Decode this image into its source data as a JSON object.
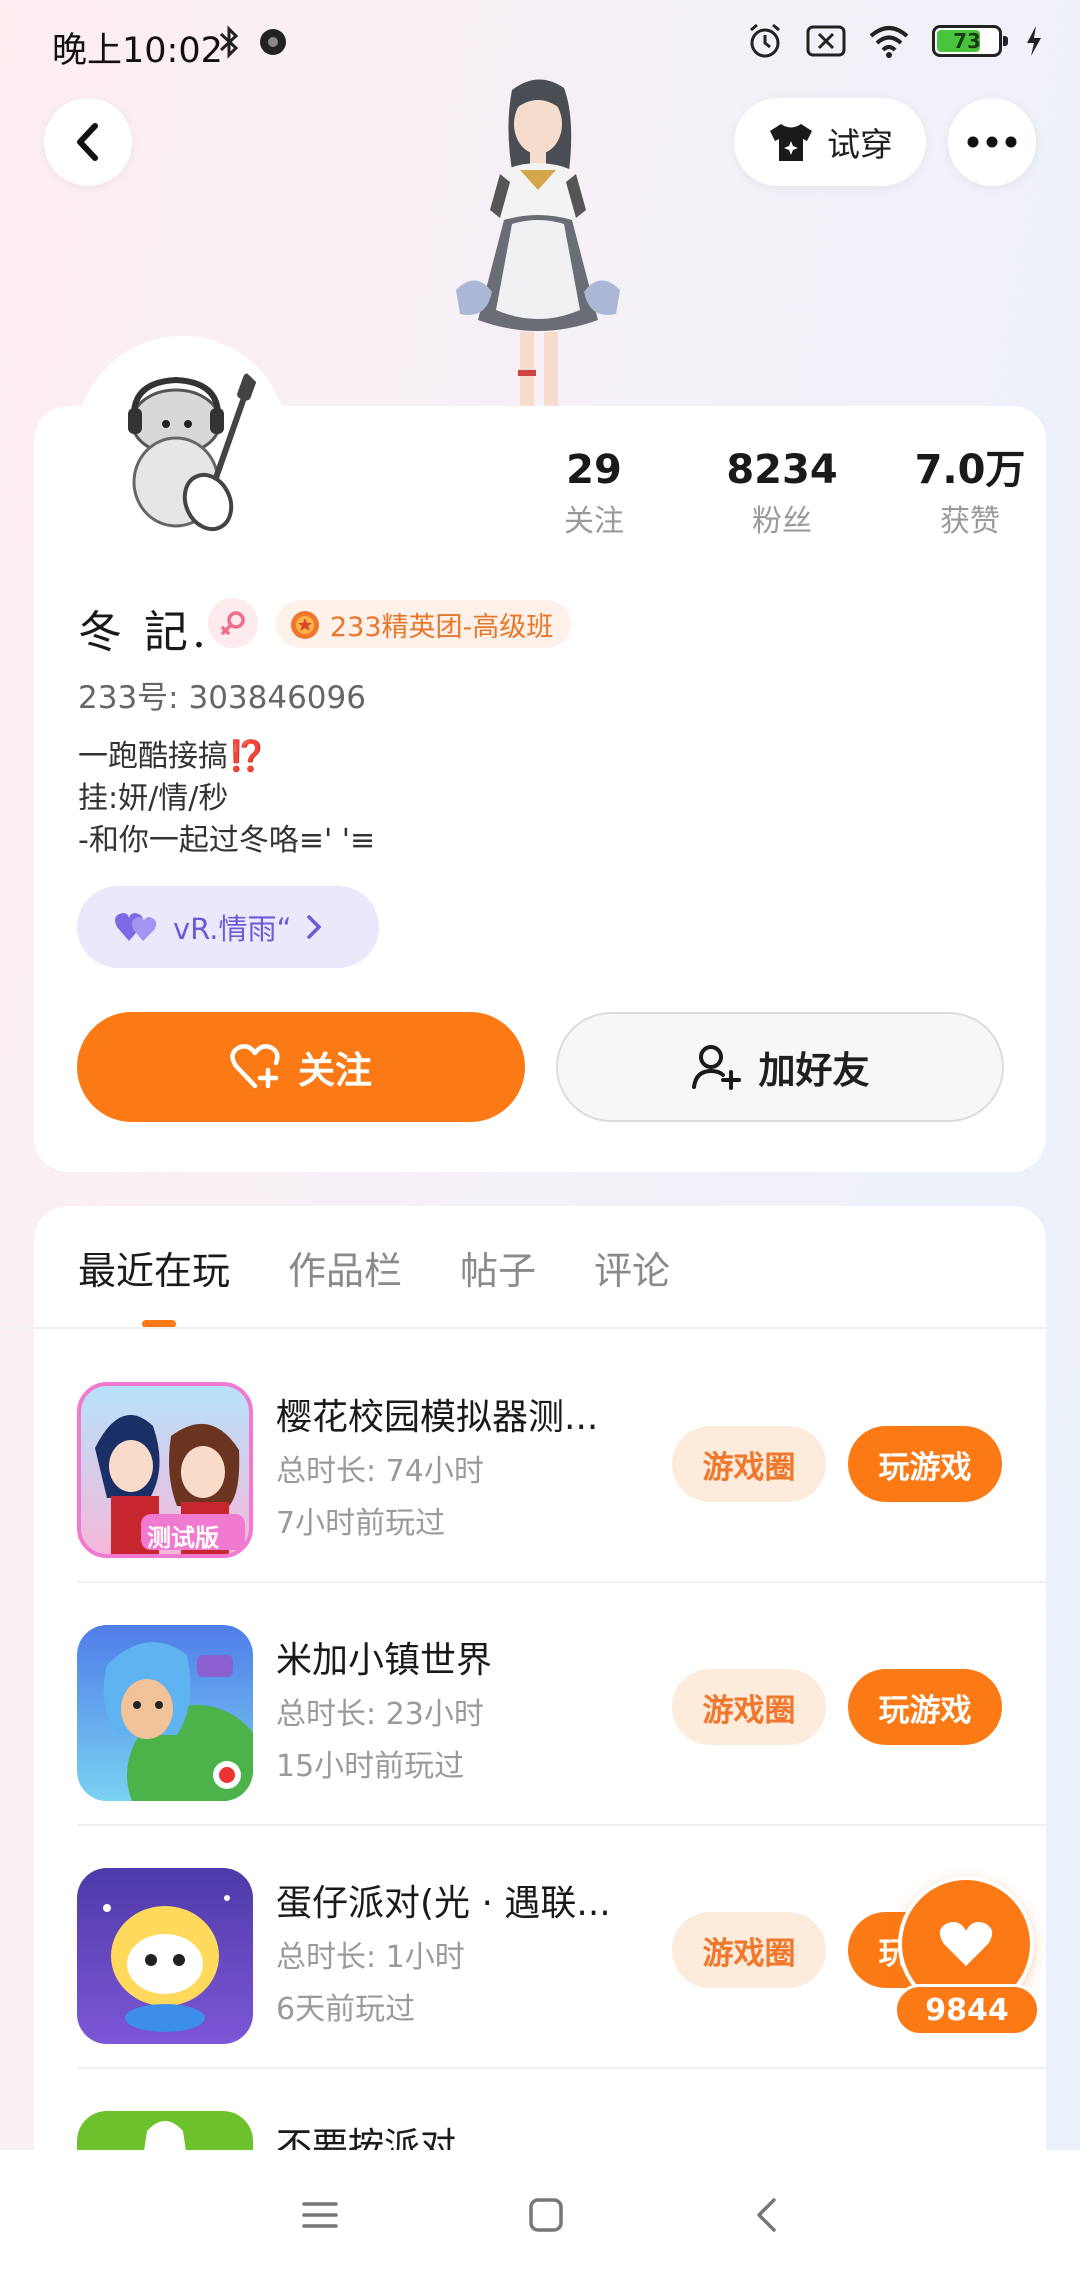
{
  "status_bar": {
    "time": "晚上10:02",
    "battery_level": 73,
    "battery_text": "73",
    "icons": [
      "bluetooth-icon",
      "record-icon",
      "alarm-icon",
      "sim-off-icon",
      "wifi-icon",
      "battery-icon",
      "charging-icon"
    ]
  },
  "header": {
    "back_icon": "chevron-left-icon",
    "tryon_label": "试穿",
    "more_icon": "more-dots-icon"
  },
  "profile": {
    "nickname": "冬 記.",
    "gender": "female",
    "vip_label": "233精英团-高级班",
    "uid_label": "233号: 303846096",
    "bio": [
      "一跑酷接搞⁉️",
      "挂:妍/情/秒",
      "-和你一起过冬咯≡' '≡"
    ],
    "team_chip_label": "vR.情雨“",
    "stats": [
      {
        "value": "29",
        "label": "关注"
      },
      {
        "value": "8234",
        "label": "粉丝"
      },
      {
        "value": "7.0万",
        "label": "获赞"
      }
    ],
    "follow_label": "关注",
    "add_friend_label": "加好友"
  },
  "tabs": [
    {
      "label": "最近在玩",
      "active": true
    },
    {
      "label": "作品栏",
      "active": false
    },
    {
      "label": "帖子",
      "active": false
    },
    {
      "label": "评论",
      "active": false
    }
  ],
  "games": [
    {
      "name": "樱花校园模拟器测...",
      "duration": "总时长: 74小时",
      "last_played": "7小时前玩过",
      "circle_label": "游戏圈",
      "play_label": "玩游戏",
      "icon_badge": "测试版"
    },
    {
      "name": "米加小镇世界",
      "duration": "总时长: 23小时",
      "last_played": "15小时前玩过",
      "circle_label": "游戏圈",
      "play_label": "玩游戏"
    },
    {
      "name": "蛋仔派对(光 · 遇联...",
      "duration": "总时长: 1小时",
      "last_played": "6天前玩过",
      "circle_label": "游戏圈",
      "play_label": "玩游戏"
    },
    {
      "name": "不要按派对"
    }
  ],
  "floating_like": {
    "count": "9844"
  },
  "colors": {
    "accent": "#fb7a16",
    "accent_light": "#fdebdc",
    "team_chip": "#ece8fb",
    "team_text": "#6a5bd6"
  }
}
